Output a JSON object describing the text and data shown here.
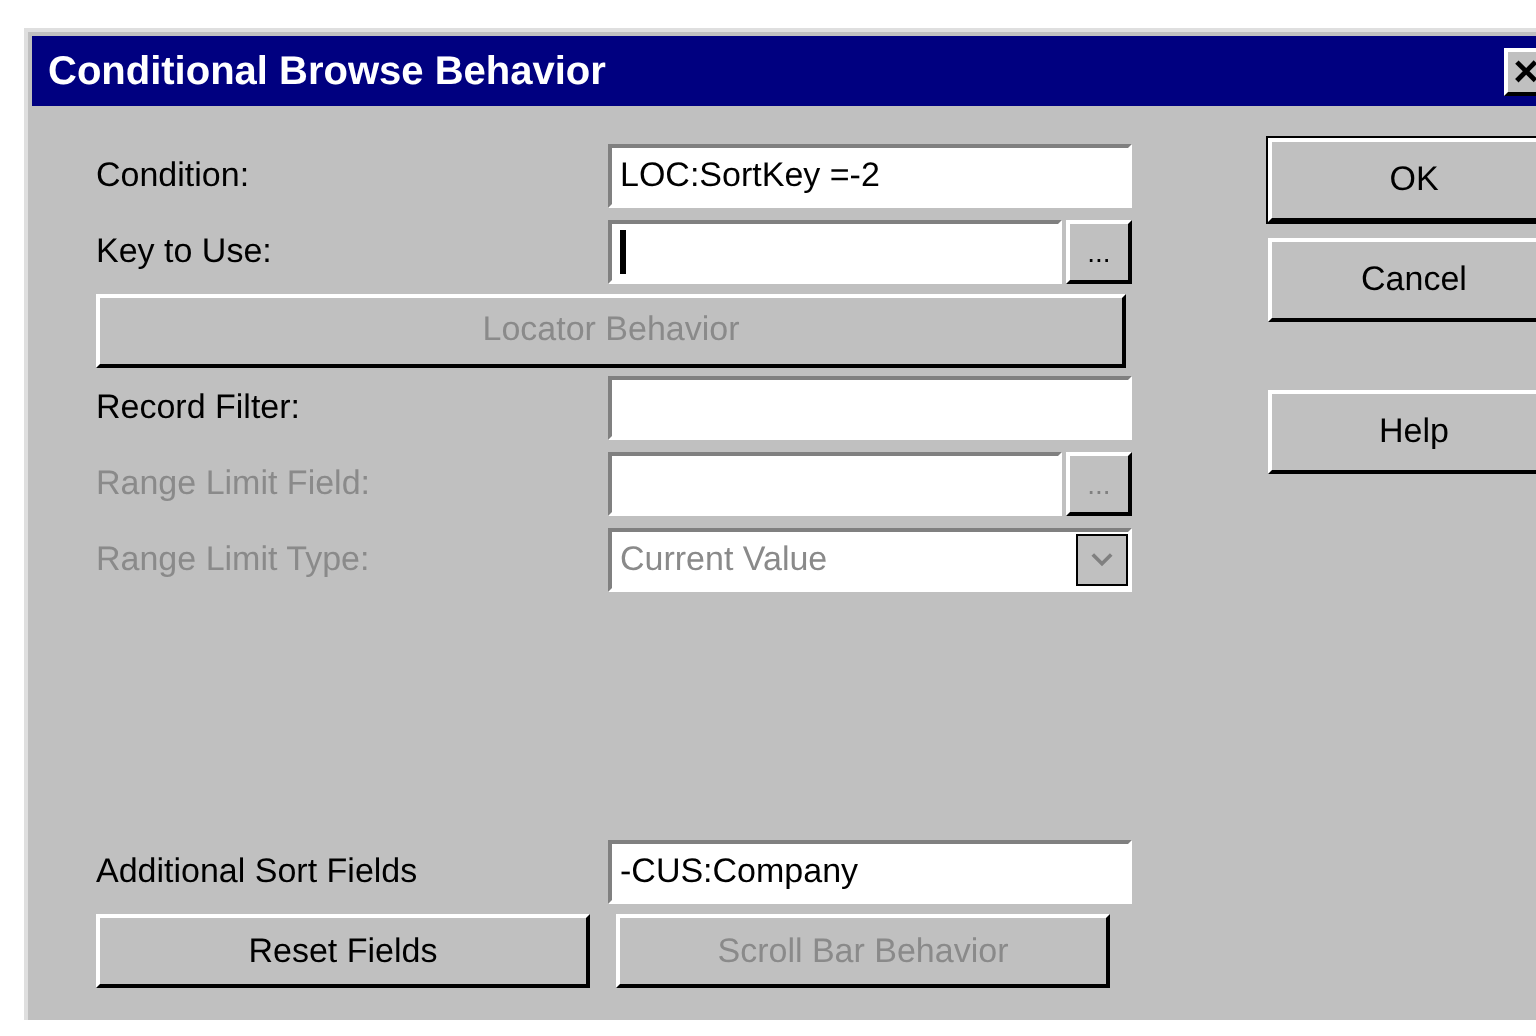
{
  "window": {
    "title": "Conditional Browse Behavior",
    "close": "×"
  },
  "rows": [
    {
      "kind": "text",
      "label": "Condition:",
      "value": "LOC:SortKey =-2",
      "disabled": false,
      "caret": false
    },
    {
      "kind": "lookup",
      "label": "Key to Use:",
      "value": "",
      "button": "...",
      "disabled": false,
      "caret": true
    },
    {
      "kind": "wide_button",
      "label": "Locator Behavior",
      "disabled": true
    },
    {
      "kind": "text",
      "label": "Record Filter:",
      "value": "",
      "disabled": false,
      "caret": false
    },
    {
      "kind": "lookup",
      "label": "Range Limit Field:",
      "value": "",
      "button": "...",
      "disabled": true,
      "caret": false
    },
    {
      "kind": "dropdown",
      "label": "Range Limit Type:",
      "value": "Current Value",
      "disabled": true
    }
  ],
  "sort": {
    "label": "Additional Sort Fields",
    "value": "-CUS:Company"
  },
  "bottom_buttons": [
    {
      "label": "Reset Fields",
      "disabled": false
    },
    {
      "label": "Scroll Bar Behavior",
      "disabled": true
    }
  ],
  "side_buttons": [
    {
      "label": "OK",
      "default": true
    },
    {
      "label": "Cancel",
      "default": false
    },
    {
      "label": "Help",
      "default": false
    }
  ]
}
